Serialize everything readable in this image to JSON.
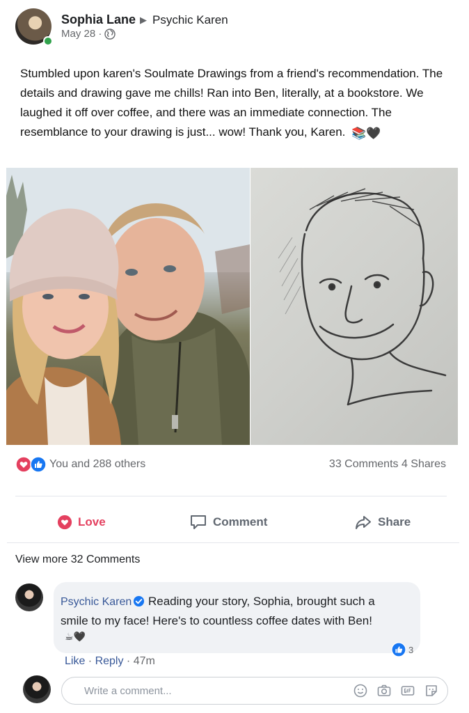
{
  "post": {
    "author": "Sophia Lane",
    "target": "Psychic Karen",
    "date": "May 28 ·",
    "text": "Stumbled upon karen's Soulmate Drawings from a friend's recommendation. The details and drawing gave me chills! Ran into Ben, literally, at a bookstore. We laughed it off over coffee, and there was an immediate connection. The resemblance to your drawing is just... wow! Thank you, Karen.",
    "text_emoji": "📚🖤",
    "photos": [
      {
        "kind": "selfie-photo"
      },
      {
        "kind": "pencil-sketch"
      }
    ],
    "reactions_text": "You and 288 others",
    "reaction_icons": [
      "love-icon",
      "like-icon"
    ],
    "comments_shares": "33 Comments 4 Shares"
  },
  "actions": {
    "love": "Love",
    "comment": "Comment",
    "share": "Share"
  },
  "comments_section": {
    "view_more": "View more 32 Comments",
    "comment": {
      "author": "Psychic Karen",
      "line1": "Reading your story, Sophia, brought such a",
      "line2": "smile to my face! Here's to countless coffee dates with Ben!",
      "emoji": "☕🖤",
      "likes": "3",
      "like_label": "Like",
      "reply_label": "Reply",
      "time": "47m"
    },
    "input_placeholder": "Write a comment..."
  },
  "colors": {
    "link": "#385898",
    "love": "#e4405f",
    "like": "#1877f2",
    "online": "#31a24c"
  }
}
